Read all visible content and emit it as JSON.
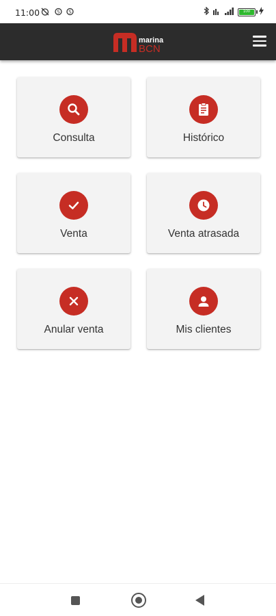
{
  "status_bar": {
    "time": "11:00",
    "battery_level": "100"
  },
  "app_bar": {
    "logo_small_text": "marina",
    "logo_big_text": "BCN",
    "brand_color": "#c62d24"
  },
  "menu": {
    "items": [
      {
        "label": "Consulta",
        "icon": "search-icon"
      },
      {
        "label": "Histórico",
        "icon": "clipboard-icon"
      },
      {
        "label": "Venta",
        "icon": "check-icon"
      },
      {
        "label": "Venta atrasada",
        "icon": "clock-icon"
      },
      {
        "label": "Anular venta",
        "icon": "close-icon"
      },
      {
        "label": "Mis clientes",
        "icon": "person-icon"
      }
    ]
  },
  "nav_bar": {
    "items": [
      "recent-apps-icon",
      "home-icon",
      "back-icon"
    ]
  }
}
